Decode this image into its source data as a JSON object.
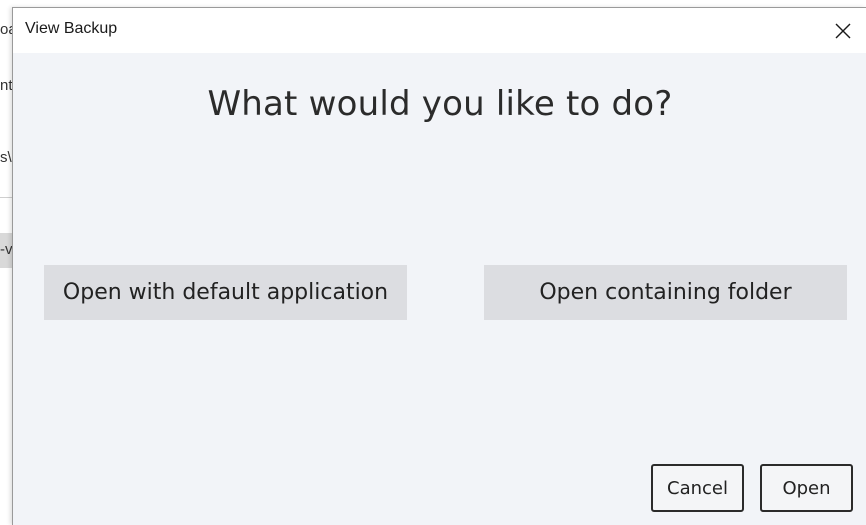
{
  "background": {
    "fragments": [
      "oa",
      "nt",
      "s\\",
      "-v"
    ]
  },
  "dialog": {
    "title": "View Backup",
    "close_icon": "close-icon",
    "question": "What would you like to do?",
    "choices": {
      "default_app_label": "Open with default application",
      "containing_folder_label": "Open containing folder"
    },
    "actions": {
      "cancel_label": "Cancel",
      "open_label": "Open"
    }
  },
  "colors": {
    "dialog_bg": "#f2f4f8",
    "choice_bg": "#dcdde1",
    "button_border": "#2b2b2b"
  }
}
